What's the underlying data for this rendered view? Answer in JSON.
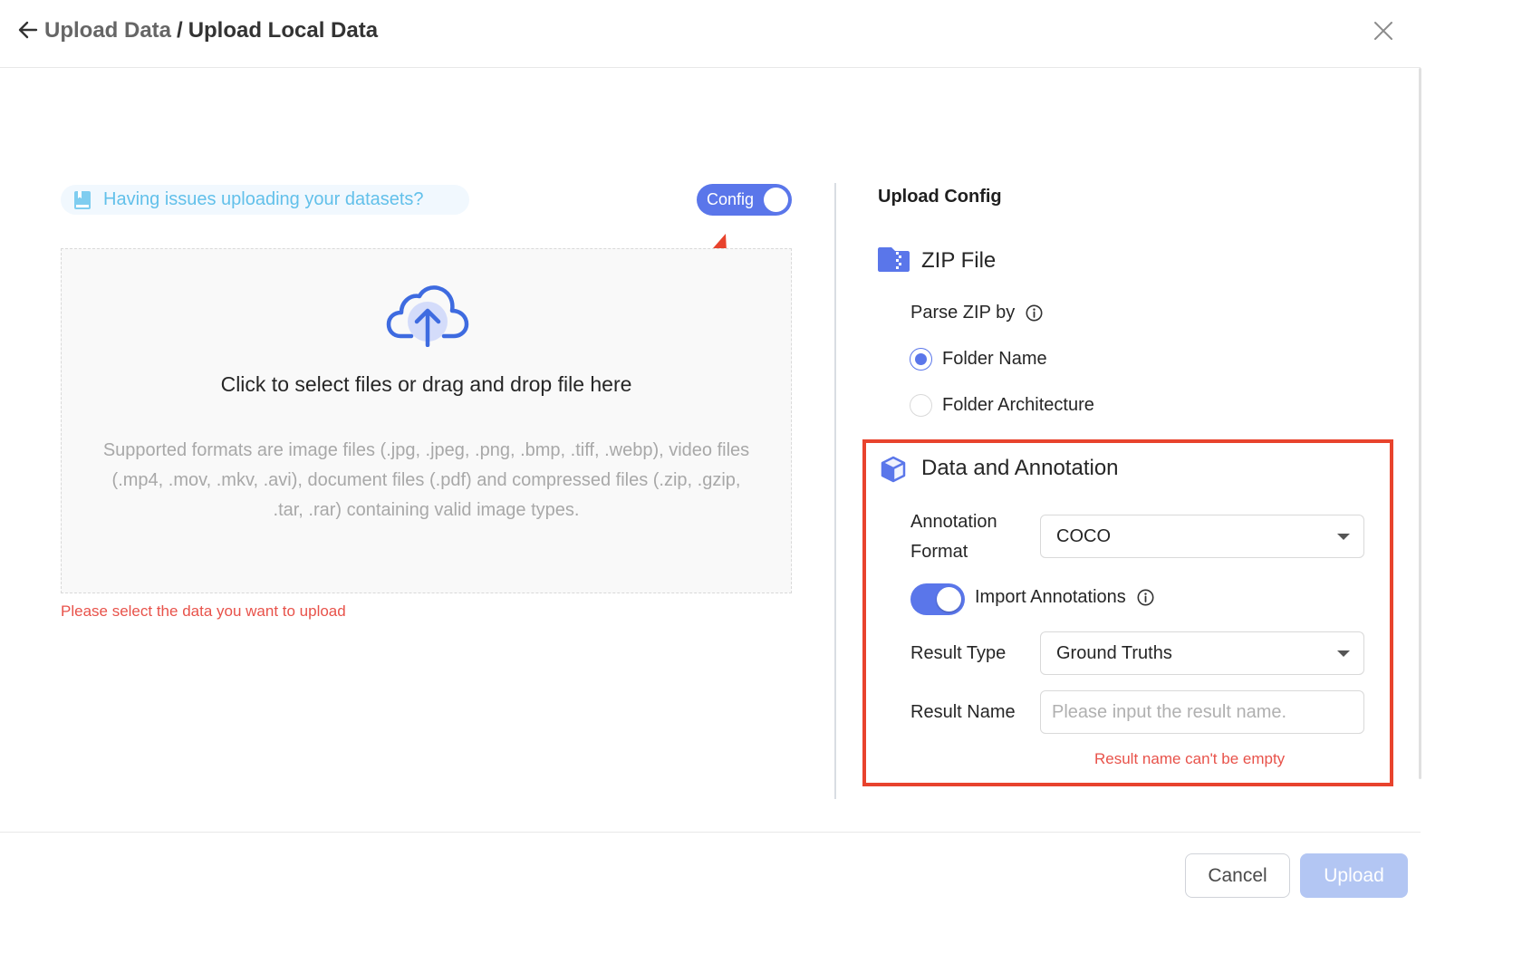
{
  "header": {
    "breadcrumb_parent": "Upload Data",
    "breadcrumb_separator": "/",
    "breadcrumb_current": "Upload Local Data",
    "back_icon": "arrow-left-icon",
    "close_icon": "close-icon"
  },
  "left": {
    "help_link": "Having issues uploading your datasets?",
    "config_toggle_label": "Config",
    "config_toggle_on": true,
    "dropzone_title": "Click to select files or drag and drop file here",
    "dropzone_description": "Supported formats are image files (.jpg, .jpeg, .png, .bmp, .tiff, .webp), video files (.mp4, .mov, .mkv, .avi), document files (.pdf) and compressed files (.zip, .gzip, .tar, .rar) containing valid image types.",
    "error": "Please select the data you want to upload"
  },
  "right": {
    "title": "Upload Config",
    "zip_section": {
      "title": "ZIP File",
      "parse_label": "Parse ZIP by",
      "options": [
        {
          "label": "Folder Name",
          "checked": true
        },
        {
          "label": "Folder Architecture",
          "checked": false
        }
      ]
    },
    "annotation_section": {
      "title": "Data and Annotation",
      "format_label_line1": "Annotation",
      "format_label_line2": "Format",
      "format_value": "COCO",
      "import_label": "Import Annotations",
      "import_on": true,
      "result_type_label": "Result Type",
      "result_type_value": "Ground Truths",
      "result_name_label": "Result Name",
      "result_name_value": "",
      "result_name_placeholder": "Please input the result name.",
      "error": "Result name can't be empty"
    }
  },
  "footer": {
    "cancel_label": "Cancel",
    "upload_label": "Upload"
  },
  "colors": {
    "accent": "#5a76ea",
    "error": "#e8524a",
    "highlight_box": "#e8432d",
    "help_text": "#62c0ea",
    "upload_disabled": "#b3c6f3"
  }
}
